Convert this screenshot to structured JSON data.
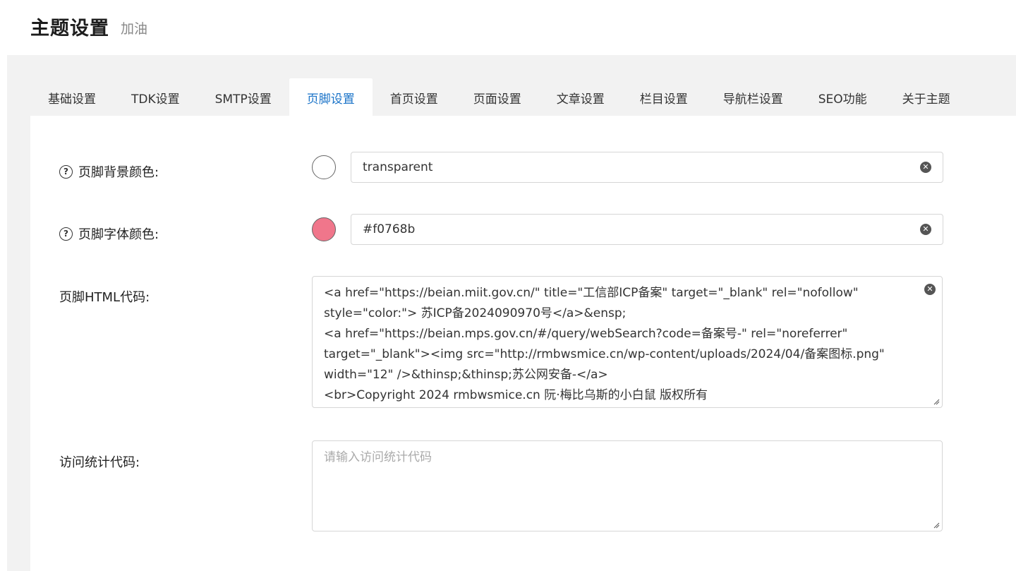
{
  "header": {
    "title": "主题设置",
    "subtitle": "加油"
  },
  "tabs": [
    {
      "label": "基础设置",
      "active": false
    },
    {
      "label": "TDK设置",
      "active": false
    },
    {
      "label": "SMTP设置",
      "active": false
    },
    {
      "label": "页脚设置",
      "active": true
    },
    {
      "label": "首页设置",
      "active": false
    },
    {
      "label": "页面设置",
      "active": false
    },
    {
      "label": "文章设置",
      "active": false
    },
    {
      "label": "栏目设置",
      "active": false
    },
    {
      "label": "导航栏设置",
      "active": false
    },
    {
      "label": "SEO功能",
      "active": false
    },
    {
      "label": "关于主题",
      "active": false
    }
  ],
  "form": {
    "footer_bg": {
      "label": "页脚背景颜色:",
      "value": "transparent",
      "swatch_color": "#ffffff"
    },
    "footer_font": {
      "label": "页脚字体颜色:",
      "value": "#f0768b",
      "swatch_color": "#f0768b"
    },
    "footer_html": {
      "label": "页脚HTML代码:",
      "lines": [
        "<a href=\"https://beian.miit.gov.cn/\" title=\"工信部ICP备案\" target=\"_blank\" rel=\"nofollow\"",
        "style=\"color:\"> 苏ICP备2024090970号</a>&ensp;",
        "<a href=\"https://beian.mps.gov.cn/#/query/webSearch?code=备案号-\" rel=\"noreferrer\"",
        "target=\"_blank\"><img src=\"http://rmbwsmice.cn/wp-content/uploads/2024/04/备案图标.png\"",
        "width=\"12\" />&thinsp;&thinsp;苏公网安备-</a>",
        "<br>Copyright 2024 rmbwsmice.cn 阮·梅比乌斯的小白鼠 版权所有"
      ]
    },
    "stats_code": {
      "label": "访问统计代码:",
      "placeholder": "请输入访问统计代码",
      "value": ""
    }
  },
  "colors": {
    "accent": "#1a73c8",
    "panel_bg": "#f2f2f2"
  }
}
